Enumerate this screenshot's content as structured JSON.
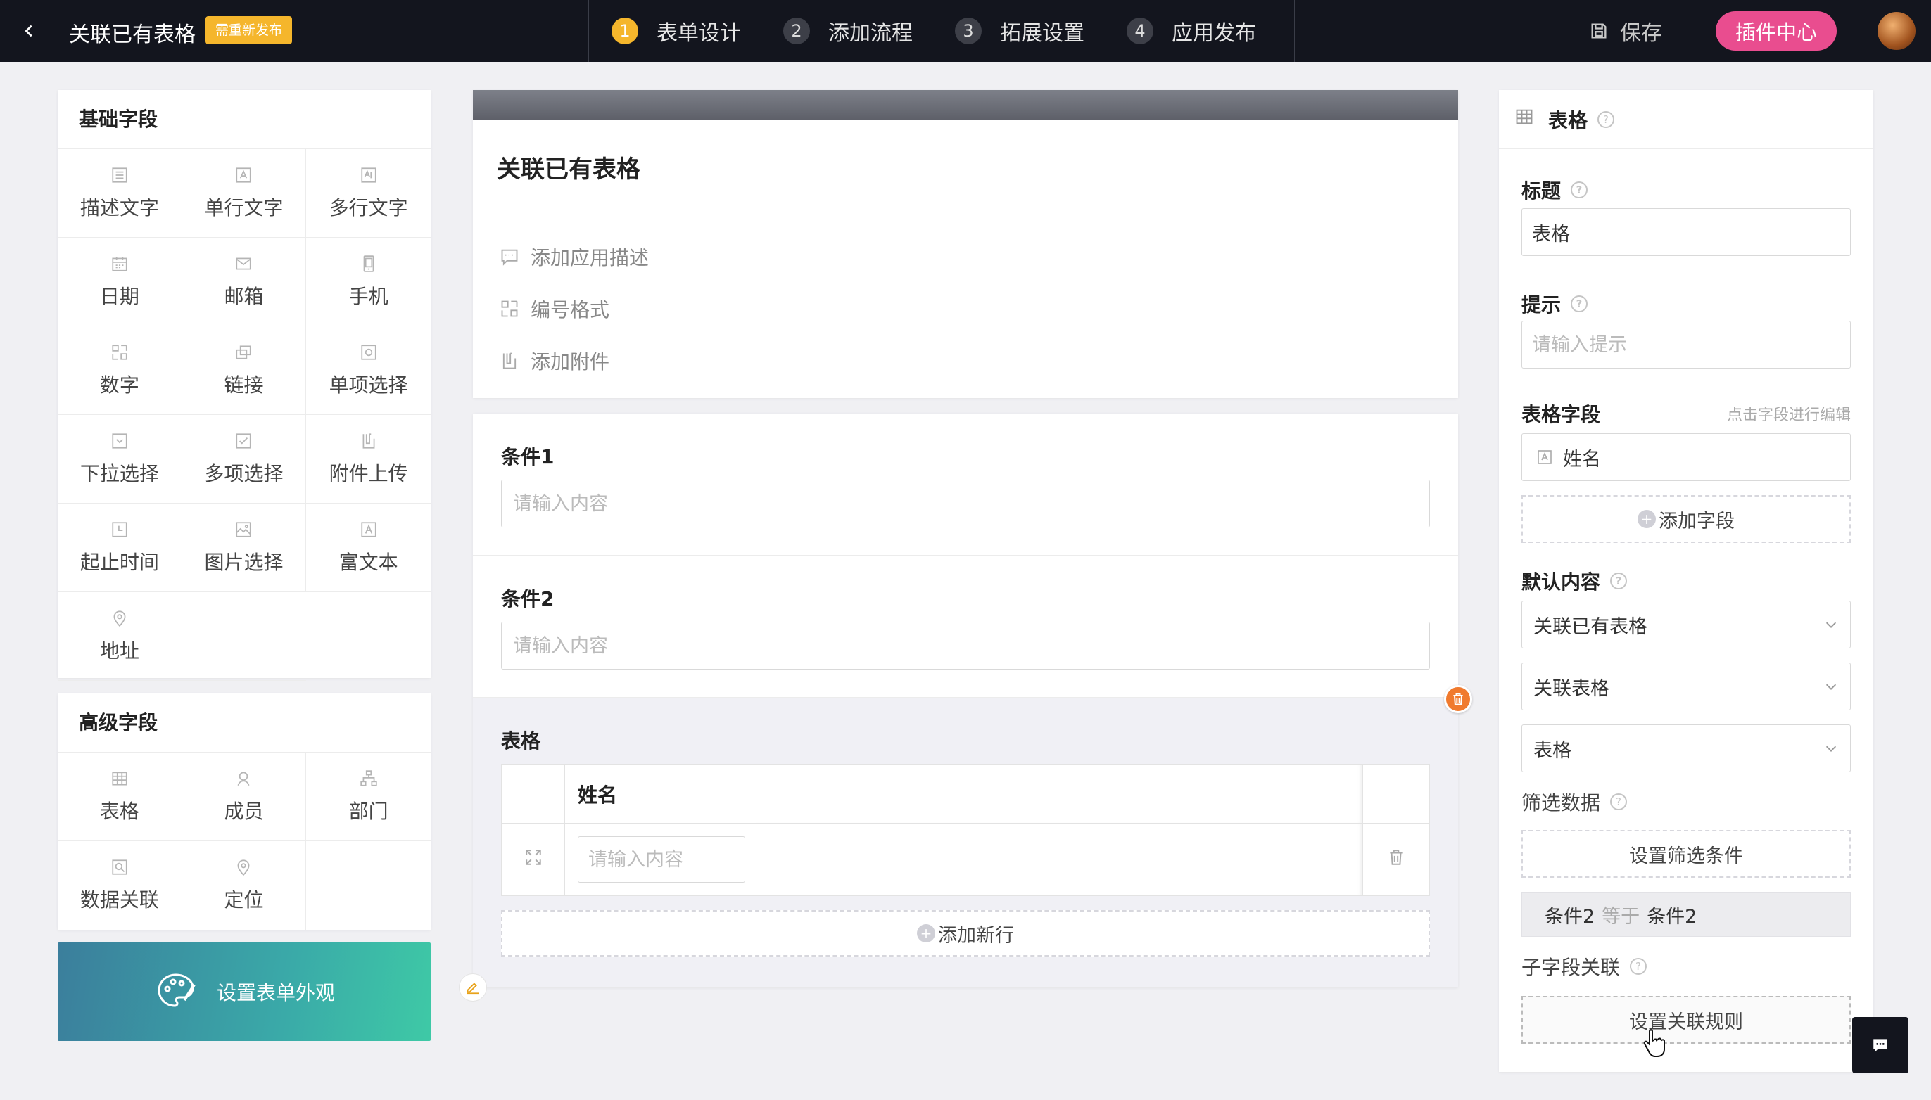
{
  "header": {
    "app_title": "关联已有表格",
    "badge": "需重新发布",
    "steps": [
      {
        "num": "1",
        "label": "表单设计"
      },
      {
        "num": "2",
        "label": "添加流程"
      },
      {
        "num": "3",
        "label": "拓展设置"
      },
      {
        "num": "4",
        "label": "应用发布"
      }
    ],
    "save_label": "保存",
    "plugin_label": "插件中心"
  },
  "basic_fields": {
    "title": "基础字段",
    "items": [
      "描述文字",
      "单行文字",
      "多行文字",
      "日期",
      "邮箱",
      "手机",
      "数字",
      "链接",
      "单项选择",
      "下拉选择",
      "多项选择",
      "附件上传",
      "起止时间",
      "图片选择",
      "富文本",
      "地址"
    ]
  },
  "advanced_fields": {
    "title": "高级字段",
    "items": [
      "表格",
      "成员",
      "部门",
      "数据关联",
      "定位"
    ]
  },
  "appearance_label": "设置表单外观",
  "form": {
    "title": "关联已有表格",
    "meta": [
      "添加应用描述",
      "编号格式",
      "添加附件"
    ],
    "conditions": [
      {
        "label": "条件1",
        "placeholder": "请输入内容"
      },
      {
        "label": "条件2",
        "placeholder": "请输入内容"
      }
    ],
    "table": {
      "label": "表格",
      "column": "姓名",
      "cell_placeholder": "请输入内容",
      "add_row": "添加新行"
    }
  },
  "props": {
    "header_title": "表格",
    "title_label": "标题",
    "title_value": "表格",
    "hint_label": "提示",
    "hint_placeholder": "请输入提示",
    "fields_label": "表格字段",
    "fields_hint": "点击字段进行编辑",
    "field_item": "姓名",
    "add_field": "添加字段",
    "default_label": "默认内容",
    "selects": [
      "关联已有表格",
      "关联表格",
      "表格"
    ],
    "filter_label": "筛选数据",
    "filter_btn": "设置筛选条件",
    "filter_rule": {
      "left": "条件2",
      "op": "等于",
      "right": "条件2"
    },
    "subfield_label": "子字段关联",
    "subfield_btn": "设置关联规则"
  },
  "colors": {
    "topbar": "#13151e",
    "active_step": "#f5b62c",
    "plugin": "#e94d8f",
    "delete": "#f07a2e"
  }
}
